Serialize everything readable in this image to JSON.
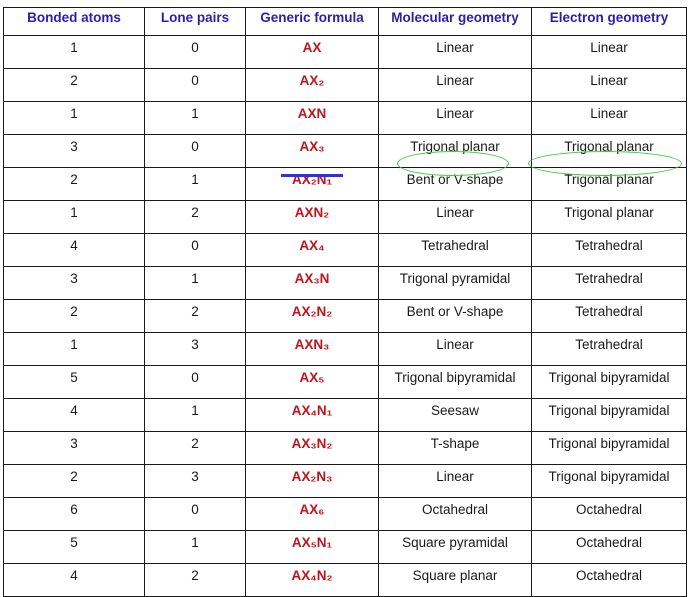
{
  "headers": [
    "Bonded atoms",
    "Lone pairs",
    "Generic formula",
    "Molecular geometry",
    "Electron geometry"
  ],
  "rows": [
    {
      "bonded": "1",
      "lone": "0",
      "formula": "AX",
      "molecular": "Linear",
      "electron": "Linear"
    },
    {
      "bonded": "2",
      "lone": "0",
      "formula": "AX₂",
      "molecular": "Linear",
      "electron": "Linear"
    },
    {
      "bonded": "1",
      "lone": "1",
      "formula": "AXN",
      "molecular": "Linear",
      "electron": "Linear"
    },
    {
      "bonded": "3",
      "lone": "0",
      "formula": "AX₃",
      "molecular": "Trigonal planar",
      "electron": "Trigonal planar"
    },
    {
      "bonded": "2",
      "lone": "1",
      "formula": "AX₂N₁",
      "molecular": "Bent or V-shape",
      "electron": "Trigonal planar"
    },
    {
      "bonded": "1",
      "lone": "2",
      "formula": "AXN₂",
      "molecular": "Linear",
      "electron": "Trigonal planar"
    },
    {
      "bonded": "4",
      "lone": "0",
      "formula": "AX₄",
      "molecular": "Tetrahedral",
      "electron": "Tetrahedral"
    },
    {
      "bonded": "3",
      "lone": "1",
      "formula": "AX₃N",
      "molecular": "Trigonal pyramidal",
      "electron": "Tetrahedral"
    },
    {
      "bonded": "2",
      "lone": "2",
      "formula": "AX₂N₂",
      "molecular": "Bent or V-shape",
      "electron": "Tetrahedral"
    },
    {
      "bonded": "1",
      "lone": "3",
      "formula": "AXN₃",
      "molecular": "Linear",
      "electron": "Tetrahedral"
    },
    {
      "bonded": "5",
      "lone": "0",
      "formula": "AX₅",
      "molecular": "Trigonal bipyramidal",
      "electron": "Trigonal bipyramidal"
    },
    {
      "bonded": "4",
      "lone": "1",
      "formula": "AX₄N₁",
      "molecular": "Seesaw",
      "electron": "Trigonal bipyramidal"
    },
    {
      "bonded": "3",
      "lone": "2",
      "formula": "AX₃N₂",
      "molecular": "T-shape",
      "electron": "Trigonal bipyramidal"
    },
    {
      "bonded": "2",
      "lone": "3",
      "formula": "AX₂N₃",
      "molecular": "Linear",
      "electron": "Trigonal bipyramidal"
    },
    {
      "bonded": "6",
      "lone": "0",
      "formula": "AX₆",
      "molecular": "Octahedral",
      "electron": "Octahedral"
    },
    {
      "bonded": "5",
      "lone": "1",
      "formula": "AX₅N₁",
      "molecular": "Square pyramidal",
      "electron": "Octahedral"
    },
    {
      "bonded": "4",
      "lone": "2",
      "formula": "AX₄N₂",
      "molecular": "Square planar",
      "electron": "Octahedral"
    }
  ],
  "highlight": {
    "row_index": 4,
    "underline_color": "#2e32e0",
    "ellipse_color": "#3ccf3c"
  },
  "colors": {
    "header": "#2b1fa8",
    "formula": "#c0121a"
  }
}
